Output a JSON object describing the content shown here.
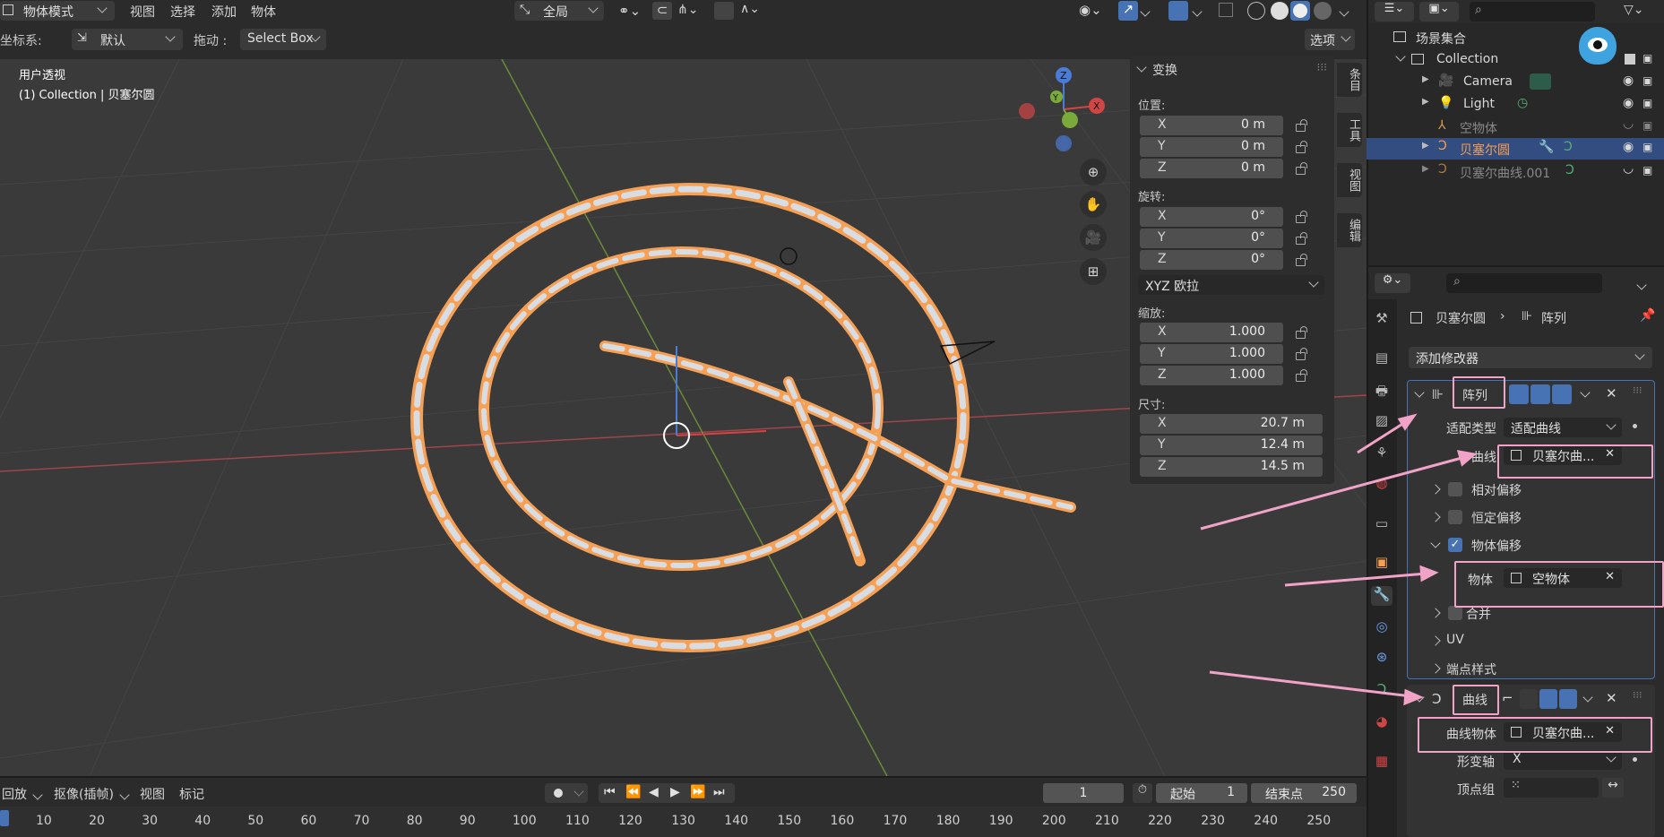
{
  "header": {
    "mode": "物体模式",
    "menus": [
      "视图",
      "选择",
      "添加",
      "物体"
    ],
    "pivot": "全局"
  },
  "toolbar2": {
    "coord_label": "坐标系:",
    "coord_value": "默认",
    "drag_label": "拖动 :",
    "drag_value": "Select Box",
    "options": "选项"
  },
  "viewport": {
    "view_name": "用户透视",
    "context": "(1) Collection | 贝塞尔圆"
  },
  "transform_panel": {
    "title": "变换",
    "location_label": "位置:",
    "location": [
      {
        "axis": "X",
        "value": "0 m"
      },
      {
        "axis": "Y",
        "value": "0 m"
      },
      {
        "axis": "Z",
        "value": "0 m"
      }
    ],
    "rotation_label": "旋转:",
    "rotation": [
      {
        "axis": "X",
        "value": "0°"
      },
      {
        "axis": "Y",
        "value": "0°"
      },
      {
        "axis": "Z",
        "value": "0°"
      }
    ],
    "rotation_mode": "XYZ 欧拉",
    "scale_label": "缩放:",
    "scale": [
      {
        "axis": "X",
        "value": "1.000"
      },
      {
        "axis": "Y",
        "value": "1.000"
      },
      {
        "axis": "Z",
        "value": "1.000"
      }
    ],
    "dimensions_label": "尺寸:",
    "dimensions": [
      {
        "axis": "X",
        "value": "20.7 m"
      },
      {
        "axis": "Y",
        "value": "12.4 m"
      },
      {
        "axis": "Z",
        "value": "14.5 m"
      }
    ]
  },
  "side_tabs": [
    "条目",
    "工具",
    "视图",
    "编辑"
  ],
  "outliner": {
    "scene_collection": "场景集合",
    "items": [
      {
        "name": "Collection"
      },
      {
        "name": "Camera"
      },
      {
        "name": "Light"
      },
      {
        "name": "空物体"
      },
      {
        "name": "贝塞尔圆"
      },
      {
        "name": "贝塞尔曲线.001"
      }
    ]
  },
  "properties": {
    "breadcrumb_object": "贝塞尔圆",
    "breadcrumb_modifier": "阵列",
    "add_modifier": "添加修改器",
    "array": {
      "name": "阵列",
      "fit_type_label": "适配类型",
      "fit_type_value": "适配曲线",
      "curve_label": "曲线",
      "curve_value": "贝塞尔曲...",
      "relative_offset": "相对偏移",
      "constant_offset": "恒定偏移",
      "object_offset": "物体偏移",
      "object_label": "物体",
      "object_value": "空物体",
      "merge": "合并",
      "uv": "UV",
      "caps": "端点样式"
    },
    "curve_mod": {
      "name": "曲线",
      "curve_object_label": "曲线物体",
      "curve_object_value": "贝塞尔曲...",
      "deform_axis_label": "形变轴",
      "deform_axis_value": "X",
      "vertex_group_label": "顶点组"
    }
  },
  "timeline": {
    "playback": "回放",
    "keying": "抠像(插帧)",
    "view": "视图",
    "marker": "标记",
    "current_frame": "1",
    "start_label": "起始",
    "start_value": "1",
    "end_label": "结束点",
    "end_value": "250",
    "ticks": [
      "10",
      "20",
      "30",
      "40",
      "50",
      "60",
      "70",
      "80",
      "90",
      "100",
      "110",
      "120",
      "130",
      "140",
      "150",
      "160",
      "170",
      "180",
      "190",
      "200",
      "210",
      "220",
      "230",
      "240",
      "250"
    ]
  },
  "colors": {
    "accent_blue": "#4772b3",
    "selection_orange": "#f5a055",
    "annotation_pink": "#f0a3c7",
    "panel_bg": "#303030"
  }
}
